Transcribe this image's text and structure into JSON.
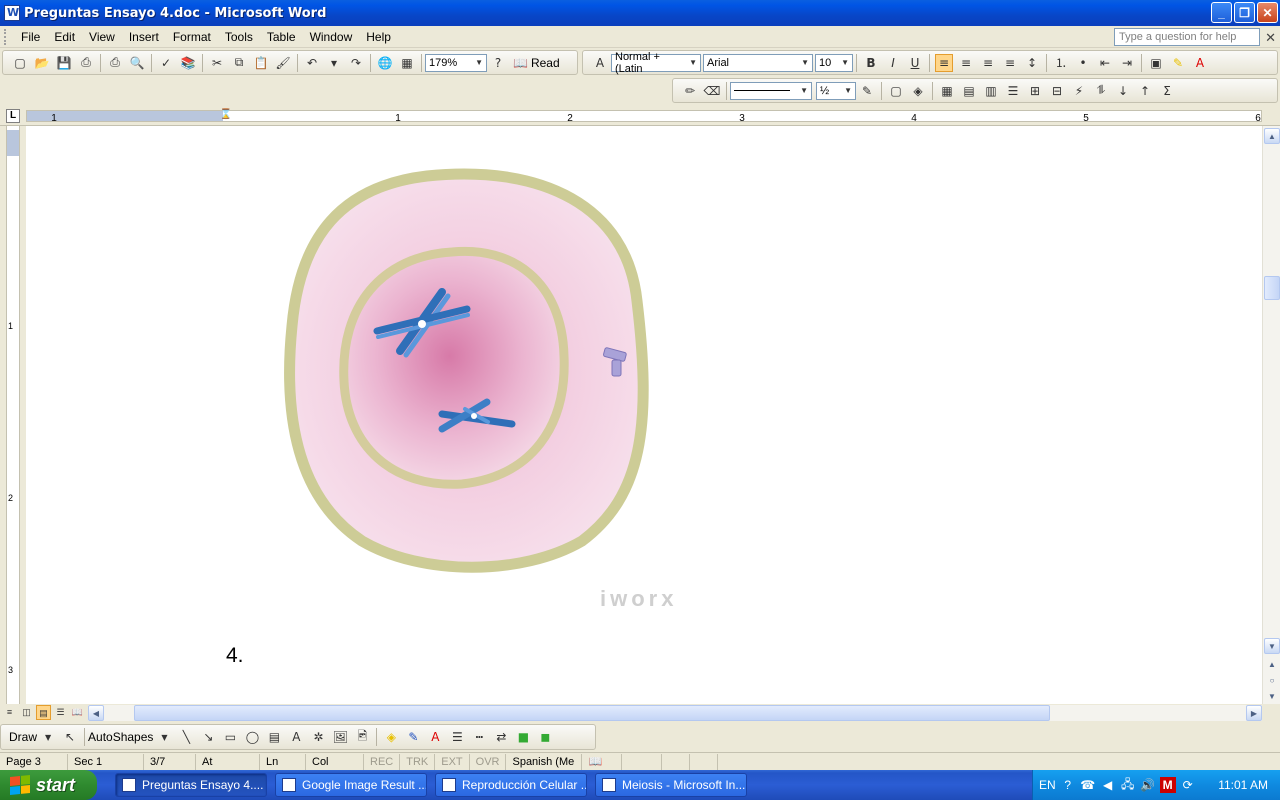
{
  "window": {
    "title": "Preguntas Ensayo 4.doc - Microsoft Word"
  },
  "menu": {
    "items": [
      "File",
      "Edit",
      "View",
      "Insert",
      "Format",
      "Tools",
      "Table",
      "Window",
      "Help"
    ],
    "help_placeholder": "Type a question for help"
  },
  "toolbar_standard": {
    "zoom": "179%",
    "read_label": "Read"
  },
  "toolbar_formatting": {
    "style": "Normal + (Latin",
    "font": "Arial",
    "size": "10"
  },
  "toolbar_tables": {
    "line_weight": "½"
  },
  "ruler": {
    "marks": [
      "1",
      "1",
      "2",
      "3",
      "4",
      "5",
      "6"
    ],
    "vmarks": [
      "1",
      "2",
      "3"
    ]
  },
  "document": {
    "question_number": "4.",
    "watermark": "iworx"
  },
  "drawbar": {
    "draw_label": "Draw",
    "autoshapes_label": "AutoShapes"
  },
  "status": {
    "page": "Page 3",
    "sec": "Sec 1",
    "pages": "3/7",
    "at": "At",
    "ln": "Ln",
    "col": "Col",
    "rec": "REC",
    "trk": "TRK",
    "ext": "EXT",
    "ovr": "OVR",
    "language": "Spanish (Me"
  },
  "taskbar": {
    "start_label": "start",
    "tasks": [
      "Preguntas Ensayo 4....",
      "Google Image Result ...",
      "Reproducción Celular ...",
      "Meiosis - Microsoft In..."
    ],
    "lang": "EN",
    "clock": "11:01 AM"
  },
  "colors": {
    "cell_membrane": "#cdcc96",
    "cytoplasm": "#f0c8dc",
    "nucleus_center": "#d77aa8",
    "chromosome": "#3d7fc6"
  }
}
